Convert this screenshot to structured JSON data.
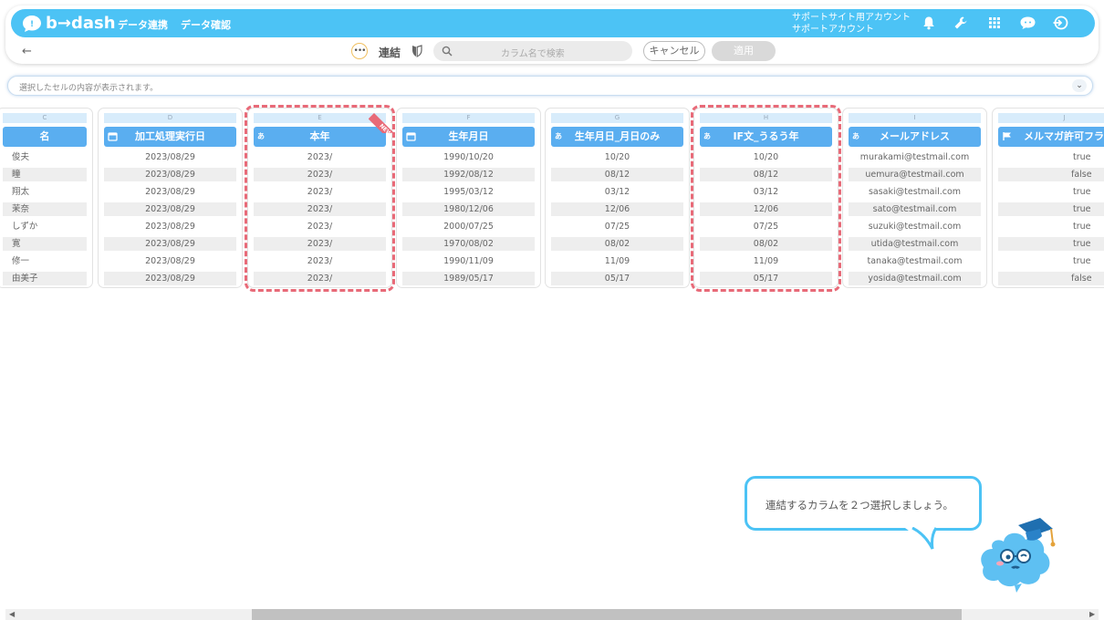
{
  "nav": {
    "logo": "b→dash",
    "links": [
      "データ連携",
      "データ確認"
    ],
    "account_line1": "サポートサイト用アカウント",
    "account_line2": "サポートアカウント",
    "icons": [
      "bell-icon",
      "wrench-icon",
      "grid-icon",
      "chat-icon",
      "logout-icon"
    ]
  },
  "toolbar": {
    "back": "←",
    "more_icon": "•••",
    "title": "連結",
    "search_placeholder": "カラム名で検索",
    "cancel_label": "キャンセル",
    "apply_label": "適用"
  },
  "cell_display": {
    "placeholder": "選択したセルの内容が表示されます。",
    "chevron": "⌄"
  },
  "columns": [
    {
      "letter": "C",
      "header": "名",
      "type_icon": "",
      "values": [
        "俊夫",
        "瞳",
        "翔太",
        "茉奈",
        "しずか",
        "寛",
        "修一",
        "由美子"
      ]
    },
    {
      "letter": "D",
      "header": "加工処理実行日",
      "type_icon": "calendar",
      "values": [
        "2023/08/29",
        "2023/08/29",
        "2023/08/29",
        "2023/08/29",
        "2023/08/29",
        "2023/08/29",
        "2023/08/29",
        "2023/08/29"
      ]
    },
    {
      "letter": "E",
      "header": "本年",
      "type_icon": "あ",
      "badge": "NEW",
      "values": [
        "2023/",
        "2023/",
        "2023/",
        "2023/",
        "2023/",
        "2023/",
        "2023/",
        "2023/"
      ]
    },
    {
      "letter": "F",
      "header": "生年月日",
      "type_icon": "calendar",
      "values": [
        "1990/10/20",
        "1992/08/12",
        "1995/03/12",
        "1980/12/06",
        "2000/07/25",
        "1970/08/02",
        "1990/11/09",
        "1989/05/17"
      ]
    },
    {
      "letter": "G",
      "header": "生年月日_月日のみ",
      "type_icon": "あ",
      "values": [
        "10/20",
        "08/12",
        "03/12",
        "12/06",
        "07/25",
        "08/02",
        "11/09",
        "05/17"
      ]
    },
    {
      "letter": "H",
      "header": "IF文_うるう年",
      "type_icon": "あ",
      "values": [
        "10/20",
        "08/12",
        "03/12",
        "12/06",
        "07/25",
        "08/02",
        "11/09",
        "05/17"
      ]
    },
    {
      "letter": "I",
      "header": "メールアドレス",
      "type_icon": "あ",
      "values": [
        "murakami@testmail.com",
        "uemura@testmail.com",
        "sasaki@testmail.com",
        "sato@testmail.com",
        "suzuki@testmail.com",
        "utida@testmail.com",
        "tanaka@testmail.com",
        "yosida@testmail.com"
      ]
    },
    {
      "letter": "J",
      "header": "メルマガ許可フラグ",
      "type_icon": "flag",
      "values": [
        "true",
        "false",
        "true",
        "true",
        "true",
        "true",
        "true",
        "false"
      ]
    }
  ],
  "guide": {
    "message": "連結するカラムを２つ選択しましょう。"
  },
  "colors": {
    "brand": "#4cc3f5",
    "header": "#5aaef0",
    "selection": "#e86a78"
  }
}
